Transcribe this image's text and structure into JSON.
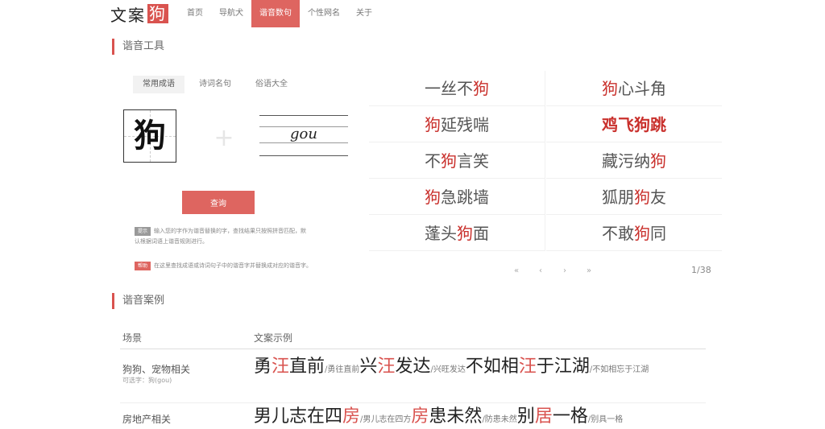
{
  "header": {
    "logo_text": "文案",
    "logo_mark": "狗",
    "nav": [
      "首页",
      "导航犬",
      "谐音数句",
      "个性网名",
      "关于"
    ]
  },
  "tool": {
    "section_title": "谐音工具",
    "tabs": [
      "常用成语",
      "诗词名句",
      "俗语大全"
    ],
    "character": "狗",
    "pinyin": "gou",
    "query_label": "查询",
    "tip1_badge": "提示",
    "tip1_line1": "输入您的字作为谐音替换的字，查找结果只按照拼音匹配，默",
    "tip1_line2": "认根据词语上谐音规则进行。",
    "tip2_badge": "帮助",
    "tip2_text": "在这里查找成语或诗词句子中的谐音字并替换成对应的谐音字。",
    "tip1_color": "#999999",
    "tip2_color": "#de6560"
  },
  "idioms": {
    "left": [
      {
        "pre": "一丝不",
        "hit": "狗",
        "post": ""
      },
      {
        "pre": "",
        "hit": "狗",
        "post": "延残喘"
      },
      {
        "pre": "不",
        "hit": "狗",
        "post": "言笑"
      },
      {
        "pre": "",
        "hit": "狗",
        "post": "急跳墙"
      },
      {
        "pre": "蓬头",
        "hit": "狗",
        "post": "面"
      }
    ],
    "right": [
      {
        "pre": "",
        "hit": "狗",
        "post": "心斗角"
      },
      {
        "pre": "鸡飞",
        "hit": "狗",
        "post": "跳"
      },
      {
        "pre": "藏污纳",
        "hit": "狗",
        "post": ""
      },
      {
        "pre": "狐朋",
        "hit": "狗",
        "post": "友"
      },
      {
        "pre": "不敢",
        "hit": "狗",
        "post": "同"
      }
    ],
    "pager": [
      "«",
      "‹",
      "›",
      "»"
    ],
    "page_count": "1/38"
  },
  "examples": {
    "section_title": "谐音案例",
    "head_scene": "场景",
    "head_examples": "文案示例",
    "rows": [
      {
        "scene": "狗狗、宠物相关",
        "sub": "可选字：狗(gou)",
        "items": [
          {
            "pre": "勇",
            "hit": "汪",
            "post": "直前",
            "orig": "/勇往直前"
          },
          {
            "pre": "兴",
            "hit": "汪",
            "post": "发达",
            "orig": "/兴旺发达"
          },
          {
            "pre": "不如相",
            "hit": "汪",
            "post": "于江湖",
            "orig": "/不如相忘于江湖"
          }
        ]
      },
      {
        "scene": "房地产相关",
        "sub": "",
        "items": [
          {
            "pre": "男儿志在四",
            "hit": "房",
            "post": "",
            "orig": "/男儿志在四方"
          },
          {
            "pre": "",
            "hit": "房",
            "post": "患未然",
            "orig": "/防患未然"
          },
          {
            "pre": "别",
            "hit": "居",
            "post": "一格",
            "orig": "/别具一格"
          }
        ]
      }
    ]
  },
  "colors": {
    "accent": "#de6560",
    "highlight": "#c9302c"
  }
}
